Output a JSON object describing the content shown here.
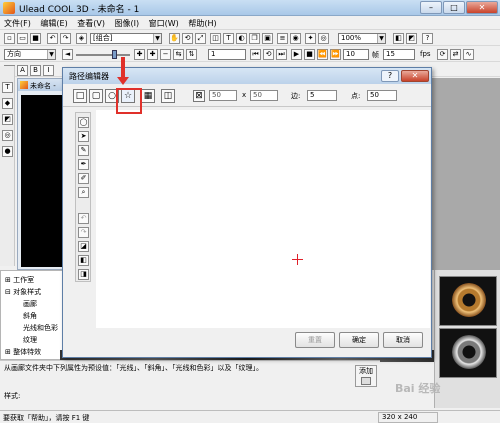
{
  "titlebar": {
    "title": "Ulead COOL 3D - 未命名 - 1",
    "min_icon": "minimize-icon",
    "max_icon": "maximize-icon",
    "close_label": "✕"
  },
  "menu": [
    "文件(F)",
    "编辑(E)",
    "查看(V)",
    "图像(I)",
    "窗口(W)",
    "帮助(H)"
  ],
  "toolbar": {
    "group_select": "[组合]",
    "zoom_select": "100%",
    "direction_select": "方向",
    "frame_value": "1",
    "count_value": "10",
    "width_label": "帧",
    "fps_value": "15",
    "fps_label": "fps"
  },
  "document": {
    "title": "未命名 -"
  },
  "tree": {
    "items": [
      "工作室",
      "对象样式",
      "画廊",
      "斜角",
      "光线和色彩",
      "纹理",
      "整体特效"
    ]
  },
  "description": {
    "text": "从画廊文件夹中下列属性为预设值：「光线」、「斜角」、「光线和色彩」以及「纹理」。",
    "style_label": "样式:",
    "add_label": "添加"
  },
  "dialog": {
    "title": "路径编辑器",
    "help_label": "?",
    "close_label": "✕",
    "width_value": "50",
    "x_label": "x",
    "height_value": "50",
    "edges_label": "边:",
    "edges_value": "5",
    "points_label": "点:",
    "points_value": "50",
    "reset_label": "重置",
    "ok_label": "确定",
    "cancel_label": "取消"
  },
  "statusbar": {
    "text": "要获取「帮助」，请按 F1 键",
    "size": "320 x 240"
  },
  "watermark": "Bai 经验",
  "colors": {
    "titlebar": "#bcd2ea",
    "highlight": "#e0302a",
    "crosshair": "#e0202a"
  }
}
